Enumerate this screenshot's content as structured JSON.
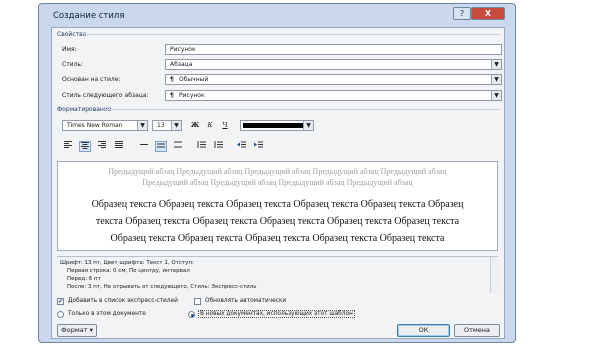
{
  "window": {
    "title": "Создание стиля",
    "help_label": "?",
    "close_label": "X"
  },
  "properties": {
    "section_title": "Свойства",
    "name_label": "Имя:",
    "name_value": "Рисунок",
    "style_label": "Стиль:",
    "style_value": "Абзаца",
    "based_label": "Основан на стиле:",
    "based_value": "Обычный",
    "next_label": "Стиль следующего абзаца:",
    "next_value": "Рисунок",
    "para_glyph": "¶"
  },
  "formatting": {
    "section_title": "Форматирование",
    "font_value": "Times New Roman",
    "size_value": "13",
    "bold_label": "Ж",
    "italic_label": "К",
    "underline_label": "Ч",
    "color_value": "#000000"
  },
  "preview": {
    "prev_lines": [
      "Предыдущий абзац Предыдущий абзац Предыдущий абзац Предыдущий абзац Предыдущий абзац",
      "Предыдущий абзац Предыдущий абзац Предыдущий абзац Предыдущий абзац"
    ],
    "sample_lines": [
      "Образец текста Образец текста Образец текста Образец текста Образец текста Образец",
      "текста Образец текста Образец текста Образец текста Образец текста Образец текста",
      "Образец текста Образец текста Образец текста Образец текста Образец текста"
    ]
  },
  "description": {
    "lines": [
      "Шрифт: 13 пт, Цвет шрифта: Текст 1, Отступ:",
      "Первая строка:  0 см, По центру, интервал",
      "Перед:  6 пт",
      "После:  3 пт, Не отрывать от следующего, Стиль: Экспресс-стиль"
    ]
  },
  "options": {
    "add_to_quick": "Добавить в список экспресс-стилей",
    "auto_update": "Обновлять автоматически",
    "only_this_doc": "Только в этом документе",
    "new_docs": "В новых документах, использующих этот шаблон",
    "check_mark": "✔"
  },
  "buttons": {
    "format": "Формат ▾",
    "ok": "ОК",
    "cancel": "Отмена"
  }
}
